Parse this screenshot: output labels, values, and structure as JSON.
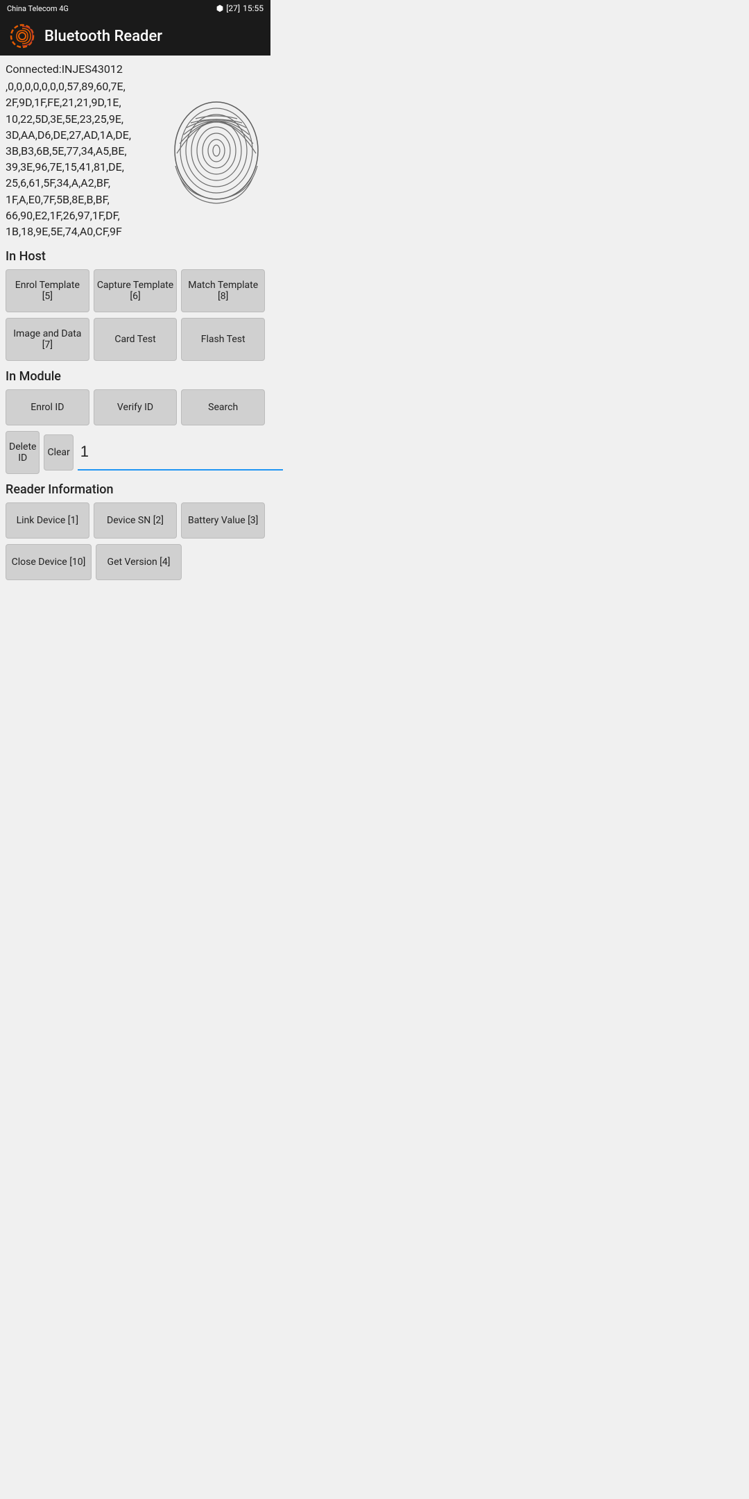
{
  "statusBar": {
    "carrier": "China Telecom 4G",
    "signalIcon": "signal",
    "wifiIcon": "wifi",
    "bluetoothIcon": "bluetooth",
    "battery": "27",
    "time": "15:55"
  },
  "appBar": {
    "title": "Bluetooth Reader",
    "iconAlt": "fingerprint-reader-icon"
  },
  "connection": {
    "statusLine": "Connected:INJES43012",
    "dataText": ",0,0,0,0,0,0,0,57,89,60,7E,\n2F,9D,1F,FE,21,21,9D,1E,\n10,22,5D,3E,5E,23,25,9E,\n3D,AA,D6,DE,27,AD,1A,DE,\n3B,B3,6B,5E,77,34,A5,BE,\n39,3E,96,7E,15,41,81,DE,\n25,6,61,5F,34,A,A2,BF,\n1F,A,E0,7F,5B,8E,B,BF,\n66,90,E2,1F,26,97,1F,DF,\n1B,18,9E,5E,74,A0,CF,9F"
  },
  "inHost": {
    "sectionLabel": "In Host",
    "buttons": {
      "enrolTemplate": "Enrol Template [5]",
      "captureTemplate": "Capture Template [6]",
      "matchTemplate": "Match Template [8]",
      "imageAndData": "Image and Data [7]",
      "cardTest": "Card Test",
      "flashTest": "Flash Test"
    }
  },
  "inModule": {
    "sectionLabel": "In Module",
    "buttons": {
      "enrolId": "Enrol ID",
      "verifyId": "Verify ID",
      "search": "Search",
      "deleteId": "Delete ID",
      "clear": "Clear"
    },
    "inputValue": "1",
    "inputPlaceholder": ""
  },
  "readerInfo": {
    "sectionLabel": "Reader Information",
    "buttons": {
      "linkDevice": "Link Device [1]",
      "deviceSN": "Device SN [2]",
      "batteryValue": "Battery Value [3]",
      "closeDevice": "Close Device [10]",
      "getVersion": "Get Version [4]"
    }
  }
}
